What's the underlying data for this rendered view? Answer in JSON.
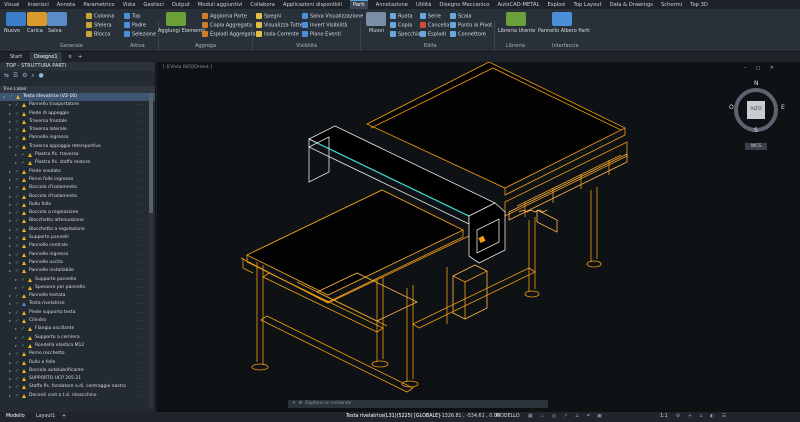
{
  "menu": [
    "Visual",
    "Inserisci",
    "Annota",
    "Parametrico",
    "Vista",
    "Gestisci",
    "Output",
    "Moduli aggiuntivi",
    "Collabora",
    "Applicazioni disponibili",
    "Parti",
    "Annotazione",
    "Utilità",
    "Disegno Meccanico",
    "AutoCAD-METAL",
    "Esplosi",
    "Top Layout",
    "Dala & Drawings",
    "Schermi",
    "Top 3D"
  ],
  "menu_active": "Parti",
  "ribbon": {
    "nuovo": "Nuovo",
    "carica": "Carica",
    "salva": "Salva",
    "colonna": "Colonna",
    "sfelera": "Sfelera",
    "blocca": "Blocca",
    "top": "Top",
    "padre": "Padre",
    "selezione": "Selezione",
    "aggiungi_elemento": "Aggiungi Elemento",
    "aggiorna_parte": "Aggiorna Parte",
    "copia_aggregata": "Copia Aggregata",
    "esplodi_aggregata": "Esplodi Aggregata",
    "spegni": "Spegni",
    "visualizza_tutte": "Visualizza Tutte",
    "isola_corrente": "Isola Corrente",
    "salva_vis": "Salva Visualizzazione",
    "invert_visibilita": "Invert Visibilità",
    "piano_eventi": "Piano Eventi",
    "muovi": "Muovi",
    "ruota": "Ruota",
    "copia": "Copia",
    "specchia": "Specchia",
    "serie": "Serie",
    "cancella": "Cancella",
    "esplodi": "Esplodi",
    "scala": "Scala",
    "punto_al_pivot": "Punto al Pivot",
    "connettore": "Connettore",
    "libreria_utente": "Libreria Utente",
    "pannello_albero": "Pannello Albero Parti"
  },
  "ribbon_groups": [
    "Generale",
    "Attiva",
    "Aggrega",
    "Visibilità",
    "Edita",
    "Libreria",
    "Interfaccia"
  ],
  "doc_tabs": [
    "Start",
    "Disegno1"
  ],
  "doc_tab_active": "Disegno1",
  "panel": {
    "title": "TOP - STRUTTURA PARTI",
    "header": "Tree Label"
  },
  "tree": [
    {
      "label": "Testa rilevatrice (V2-16)",
      "indent": 0,
      "sel": true,
      "warn": true
    },
    {
      "label": "Pannello trasportatore",
      "indent": 1,
      "warn": true
    },
    {
      "label": "Piede di appoggio",
      "indent": 1,
      "warn": true
    },
    {
      "label": "Traversa frontale",
      "indent": 1,
      "warn": true
    },
    {
      "label": "Traversa laterale",
      "indent": 1,
      "warn": true
    },
    {
      "label": "Pannello ingresso",
      "indent": 1,
      "warn": true
    },
    {
      "label": "Traversa appoggio rete/sportivo",
      "indent": 1,
      "warn": true
    },
    {
      "label": "Piastra fis. traversa",
      "indent": 2,
      "warn": true
    },
    {
      "label": "Piastra fis. staffa motore",
      "indent": 2,
      "warn": true
    },
    {
      "label": "Piede snodato",
      "indent": 1,
      "warn": true
    },
    {
      "label": "Perno folle ingresso",
      "indent": 1,
      "warn": true
    },
    {
      "label": "Boccola d'isolamento",
      "indent": 1,
      "warn": true
    },
    {
      "label": "Boccola d'isolamento",
      "indent": 1,
      "warn": true
    },
    {
      "label": "Rullo folle",
      "indent": 1,
      "warn": true
    },
    {
      "label": "Boccola a regolazione",
      "indent": 1,
      "warn": true
    },
    {
      "label": "Blocchetto attenuazione",
      "indent": 1,
      "warn": true
    },
    {
      "label": "Blocchetto a regolazione",
      "indent": 1,
      "warn": true
    },
    {
      "label": "Supporto pannelli",
      "indent": 1,
      "warn": true
    },
    {
      "label": "Pannello centrale",
      "indent": 1,
      "warn": true
    },
    {
      "label": "Pannello ingresso",
      "indent": 1,
      "warn": true
    },
    {
      "label": "Pannello uscita",
      "indent": 1,
      "warn": true
    },
    {
      "label": "Pannello installabile",
      "indent": 1,
      "warn": true
    },
    {
      "label": "Supporto pannello",
      "indent": 2,
      "warn": true
    },
    {
      "label": "Spessore per pannello",
      "indent": 2,
      "warn": true
    },
    {
      "label": "Pannello testata",
      "indent": 1,
      "warn": true
    },
    {
      "label": "Testa rivelatrice",
      "indent": 1,
      "warn": false
    },
    {
      "label": "Piede supporto testa",
      "indent": 1,
      "warn": true
    },
    {
      "label": "Cilindro",
      "indent": 1,
      "warn": true
    },
    {
      "label": "Flangia oscillante",
      "indent": 2,
      "warn": true
    },
    {
      "label": "Supporto a cerniera",
      "indent": 2,
      "warn": true
    },
    {
      "label": "Rondella elastica M12",
      "indent": 2,
      "warn": true
    },
    {
      "label": "Perno rocchetto",
      "indent": 1,
      "warn": true
    },
    {
      "label": "Rullo a folle",
      "indent": 1,
      "warn": true
    },
    {
      "label": "Boccola autolubrificante",
      "indent": 1,
      "warn": true
    },
    {
      "label": "SUPPORTO UCP 205-21",
      "indent": 1,
      "warn": true
    },
    {
      "label": "Staffa fis. fondatore a.di. centraggio nastro",
      "indent": 1,
      "warn": true
    },
    {
      "label": "Deconti cost a t.d. rimacchino",
      "indent": 1,
      "warn": true
    }
  ],
  "viewport": {
    "label": "[-][Vista ISO][Orient.]",
    "controls": "– ◻ ✕",
    "compass": {
      "n": "N",
      "s": "S",
      "e": "E",
      "o": "O",
      "center": "ALTO",
      "ucs": "WCS"
    },
    "command_placeholder": "Digitare un comando"
  },
  "status": {
    "left_tabs": [
      "Modello",
      "Layout1"
    ],
    "part": "Testa rivelatrice(L31)(5225) [GLOBALE]",
    "coords": "-1326.81 , -534.61 , 0.00",
    "mode": "MODELLO",
    "scale": "1:1"
  },
  "colors": {
    "accent": "#4aa3e0",
    "selection": "#3d5572",
    "wire": "#f39c12",
    "wire_bright": "#ffb84d",
    "wire_white": "#e8e8e8",
    "wire_cyan": "#2fd0c8",
    "warn": "#f0b429",
    "check": "#3fb950"
  }
}
